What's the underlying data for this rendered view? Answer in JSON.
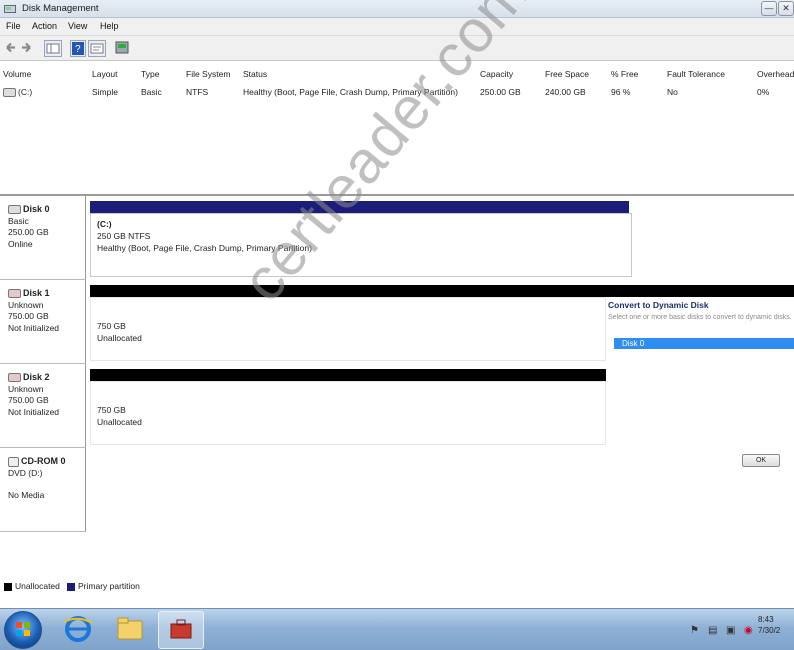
{
  "window": {
    "title": "Disk Management",
    "min_label": "—",
    "close_label": "✕"
  },
  "menu": [
    "File",
    "Action",
    "View",
    "Help"
  ],
  "toolbar": {
    "back_icon": "back-arrow-icon",
    "forward_icon": "forward-arrow-icon"
  },
  "volumes": {
    "columns": [
      "Volume",
      "Layout",
      "Type",
      "File System",
      "Status",
      "Capacity",
      "Free Space",
      "% Free",
      "Fault Tolerance",
      "Overhead"
    ],
    "rows": [
      {
        "volume": "(C:)",
        "layout": "Simple",
        "type": "Basic",
        "fs": "NTFS",
        "status": "Healthy (Boot, Page File, Crash Dump, Primary Partition)",
        "capacity": "250.00 GB",
        "free": "240.00 GB",
        "pct_free": "96 %",
        "fault": "No",
        "overhead": "0%"
      }
    ]
  },
  "disks": [
    {
      "name": "Disk 0",
      "type": "Basic",
      "size": "250.00 GB",
      "state": "Online",
      "partition": {
        "label": "(C:)",
        "line2": "250 GB NTFS",
        "line3": "Healthy (Boot, Page File, Crash Dump, Primary Partition)"
      }
    },
    {
      "name": "Disk 1",
      "type": "Unknown",
      "size": "750.00 GB",
      "state": "Not Initialized",
      "partition": {
        "line1": "750 GB",
        "line2": "Unallocated"
      }
    },
    {
      "name": "Disk 2",
      "type": "Unknown",
      "size": "750.00 GB",
      "state": "Not Initialized",
      "partition": {
        "line1": "750 GB",
        "line2": "Unallocated"
      }
    },
    {
      "name": "CD-ROM 0",
      "type": "DVD (D:)",
      "state": "No Media"
    }
  ],
  "legend": [
    {
      "label": "Unallocated",
      "color": "#000000"
    },
    {
      "label": "Primary partition",
      "color": "#1c1c7a"
    }
  ],
  "dialog": {
    "title": "Convert to Dynamic Disk",
    "text": "Select one or more basic disks to convert to dynamic disks.",
    "list_item": "Disk 0",
    "ok_label": "OK"
  },
  "taskbar": {
    "clock_time": "8:43",
    "clock_date": "7/30/2"
  },
  "watermark": "certleader.com",
  "colors": {
    "primary_partition": "#1c1c7a",
    "unallocated": "#000000",
    "selection": "#2f8cf0"
  }
}
